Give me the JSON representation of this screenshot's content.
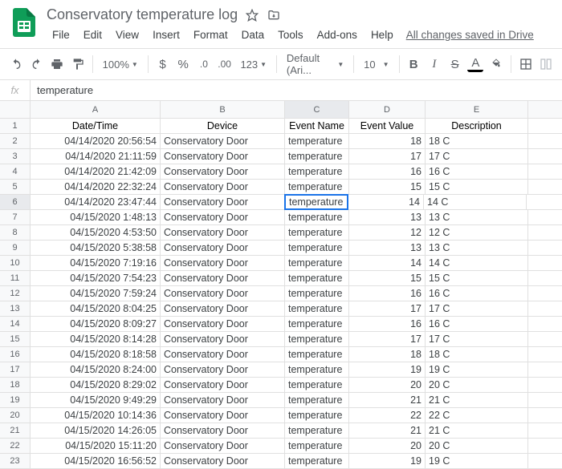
{
  "doc": {
    "title": "Conservatory temperature log"
  },
  "menu": {
    "file": "File",
    "edit": "Edit",
    "view": "View",
    "insert": "Insert",
    "format": "Format",
    "data": "Data",
    "tools": "Tools",
    "addons": "Add-ons",
    "help": "Help",
    "saved": "All changes saved in Drive"
  },
  "toolbar": {
    "zoom": "100%",
    "dollar": "$",
    "percent": "%",
    "dec_less": ".0",
    "dec_more": ".00",
    "num": "123",
    "font": "Default (Ari...",
    "size": "10",
    "bold": "B",
    "italic": "I",
    "strike": "S",
    "text_color": "A"
  },
  "fx": {
    "label": "fx",
    "value": "temperature"
  },
  "columns": [
    "A",
    "B",
    "C",
    "D",
    "E"
  ],
  "headers": {
    "A": "Date/Time",
    "B": "Device",
    "C": "Event Name",
    "D": "Event Value",
    "E": "Description"
  },
  "selected": {
    "row": 6,
    "col": "C"
  },
  "rows": [
    {
      "n": 2,
      "a": "04/14/2020 20:56:54",
      "b": "Conservatory Door",
      "c": "temperature",
      "d": "18",
      "e": "18 C"
    },
    {
      "n": 3,
      "a": "04/14/2020 21:11:59",
      "b": "Conservatory Door",
      "c": "temperature",
      "d": "17",
      "e": "17 C"
    },
    {
      "n": 4,
      "a": "04/14/2020 21:42:09",
      "b": "Conservatory Door",
      "c": "temperature",
      "d": "16",
      "e": "16 C"
    },
    {
      "n": 5,
      "a": "04/14/2020 22:32:24",
      "b": "Conservatory Door",
      "c": "temperature",
      "d": "15",
      "e": "15 C"
    },
    {
      "n": 6,
      "a": "04/14/2020 23:47:44",
      "b": "Conservatory Door",
      "c": "temperature",
      "d": "14",
      "e": "14 C"
    },
    {
      "n": 7,
      "a": "04/15/2020 1:48:13",
      "b": "Conservatory Door",
      "c": "temperature",
      "d": "13",
      "e": "13 C"
    },
    {
      "n": 8,
      "a": "04/15/2020 4:53:50",
      "b": "Conservatory Door",
      "c": "temperature",
      "d": "12",
      "e": "12 C"
    },
    {
      "n": 9,
      "a": "04/15/2020 5:38:58",
      "b": "Conservatory Door",
      "c": "temperature",
      "d": "13",
      "e": "13 C"
    },
    {
      "n": 10,
      "a": "04/15/2020 7:19:16",
      "b": "Conservatory Door",
      "c": "temperature",
      "d": "14",
      "e": "14 C"
    },
    {
      "n": 11,
      "a": "04/15/2020 7:54:23",
      "b": "Conservatory Door",
      "c": "temperature",
      "d": "15",
      "e": "15 C"
    },
    {
      "n": 12,
      "a": "04/15/2020 7:59:24",
      "b": "Conservatory Door",
      "c": "temperature",
      "d": "16",
      "e": "16 C"
    },
    {
      "n": 13,
      "a": "04/15/2020 8:04:25",
      "b": "Conservatory Door",
      "c": "temperature",
      "d": "17",
      "e": "17 C"
    },
    {
      "n": 14,
      "a": "04/15/2020 8:09:27",
      "b": "Conservatory Door",
      "c": "temperature",
      "d": "16",
      "e": "16 C"
    },
    {
      "n": 15,
      "a": "04/15/2020 8:14:28",
      "b": "Conservatory Door",
      "c": "temperature",
      "d": "17",
      "e": "17 C"
    },
    {
      "n": 16,
      "a": "04/15/2020 8:18:58",
      "b": "Conservatory Door",
      "c": "temperature",
      "d": "18",
      "e": "18 C"
    },
    {
      "n": 17,
      "a": "04/15/2020 8:24:00",
      "b": "Conservatory Door",
      "c": "temperature",
      "d": "19",
      "e": "19 C"
    },
    {
      "n": 18,
      "a": "04/15/2020 8:29:02",
      "b": "Conservatory Door",
      "c": "temperature",
      "d": "20",
      "e": "20 C"
    },
    {
      "n": 19,
      "a": "04/15/2020 9:49:29",
      "b": "Conservatory Door",
      "c": "temperature",
      "d": "21",
      "e": "21 C"
    },
    {
      "n": 20,
      "a": "04/15/2020 10:14:36",
      "b": "Conservatory Door",
      "c": "temperature",
      "d": "22",
      "e": "22 C"
    },
    {
      "n": 21,
      "a": "04/15/2020 14:26:05",
      "b": "Conservatory Door",
      "c": "temperature",
      "d": "21",
      "e": "21 C"
    },
    {
      "n": 22,
      "a": "04/15/2020 15:11:20",
      "b": "Conservatory Door",
      "c": "temperature",
      "d": "20",
      "e": "20 C"
    },
    {
      "n": 23,
      "a": "04/15/2020 16:56:52",
      "b": "Conservatory Door",
      "c": "temperature",
      "d": "19",
      "e": "19 C"
    }
  ]
}
